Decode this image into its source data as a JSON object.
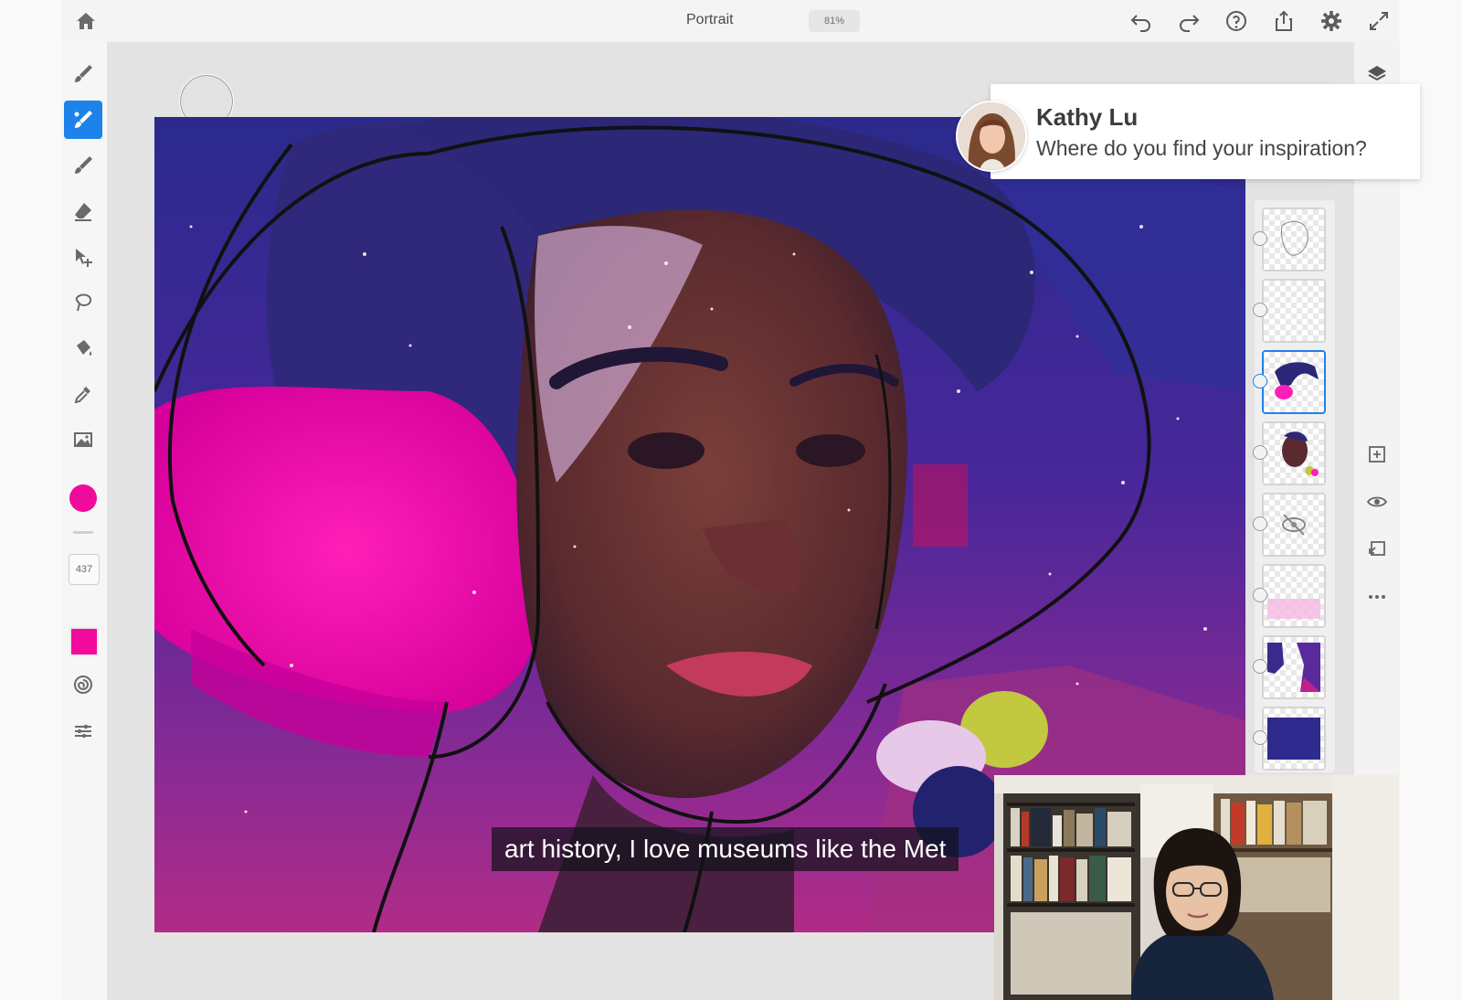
{
  "document": {
    "title": "Portrait",
    "zoom": "81%"
  },
  "toolbar_right": [
    "undo-icon",
    "redo-icon",
    "help-icon",
    "share-icon",
    "settings-icon",
    "fullscreen-icon"
  ],
  "tools": [
    "pixel-brush-icon",
    "live-brush-icon",
    "vector-brush-icon",
    "eraser-icon",
    "move-icon",
    "lasso-icon",
    "fill-icon",
    "eyedropper-icon",
    "image-icon"
  ],
  "brush_size": "437",
  "colors": {
    "accent": "#1e82eb",
    "brush": "#f10a9b"
  },
  "comment": {
    "name": "Kathy Lu",
    "text": "Where do you find your inspiration?"
  },
  "caption": "art history, I love museums like the Met",
  "layers_count": 8
}
